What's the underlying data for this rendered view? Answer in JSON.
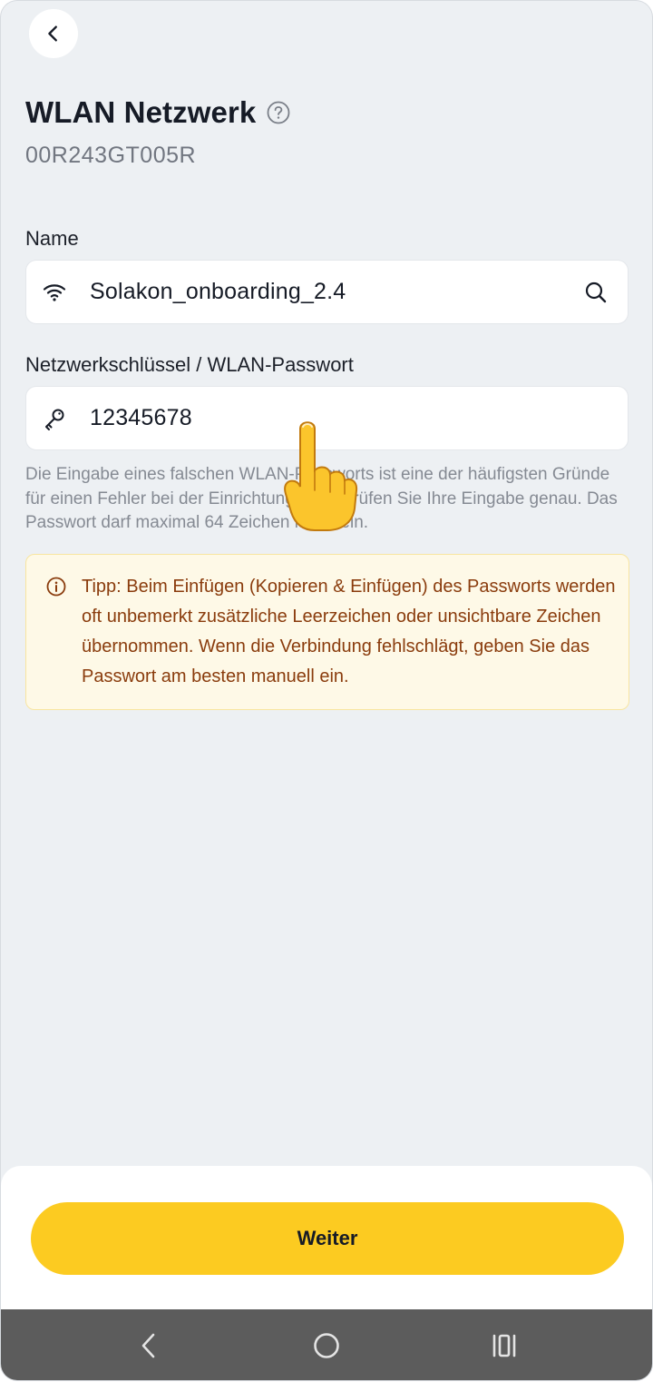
{
  "header": {
    "title": "WLAN Netzwerk",
    "serial": "00R243GT005R"
  },
  "form": {
    "name_label": "Name",
    "name_value": "Solakon_onboarding_2.4",
    "password_label": "Netzwerkschlüssel / WLAN-Passwort",
    "password_value": "12345678",
    "hint": "Die Eingabe eines falschen WLAN-Passworts ist eine der häufigsten Gründe für einen Fehler bei der Einrichtung. Bitte prüfen Sie Ihre Eingabe genau. Das Passwort darf maximal 64 Zeichen lang sein."
  },
  "tip": {
    "text": "Tipp: Beim Einfügen (Kopieren & Einfügen) des Passworts werden oft unbemerkt zusätzliche Leerzeichen oder unsichtbare Zeichen übernommen. Wenn die Verbindung fehlschlägt, geben Sie das Passwort am besten manuell ein."
  },
  "footer": {
    "continue_label": "Weiter"
  },
  "icons": {
    "back": "chevron-left-icon",
    "help": "question-circle-icon",
    "wifi": "wifi-icon",
    "search": "search-icon",
    "key": "key-icon",
    "info": "info-circle-icon",
    "pointer": "pointing-hand-emoji"
  },
  "colors": {
    "background": "#edf0f3",
    "accent": "#fccb21",
    "tip_background": "#fef9e7",
    "tip_text": "#8a3c0d",
    "nav_bar": "#5c5c5c"
  }
}
